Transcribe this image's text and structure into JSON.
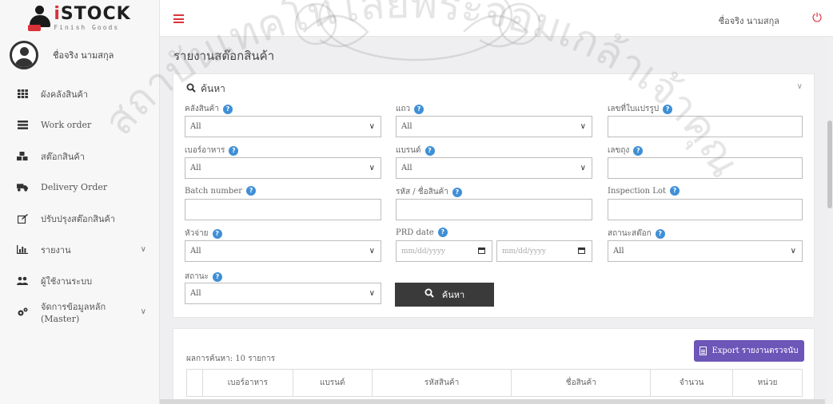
{
  "brand": {
    "title_i": "i",
    "title_rest": "STOCK",
    "subtitle": "Finish Goods",
    "emblem_text": "สถาบัน"
  },
  "colors": {
    "accent": "#d9323a",
    "export": "#6c56b8",
    "help": "#3f8fd6",
    "search_button": "#3a3a3a"
  },
  "sidebar": {
    "user_name": "ชื่อจริง นามสกุล",
    "items": [
      {
        "label": "ผังคลังสินค้า",
        "icon": "grid-icon"
      },
      {
        "label": "Work order",
        "icon": "list-icon"
      },
      {
        "label": "สต๊อกสินค้า",
        "icon": "cubes-icon"
      },
      {
        "label": "Delivery Order",
        "icon": "truck-icon"
      },
      {
        "label": "ปรับปรุงสต๊อกสินค้า",
        "icon": "edit-icon"
      },
      {
        "label": "รายงาน",
        "icon": "bar-chart-icon",
        "chevron": "∨"
      },
      {
        "label": "ผู้ใช้งานระบบ",
        "icon": "users-icon"
      },
      {
        "label": "จัดการข้อมูลหลัก (Master)",
        "icon": "gears-icon",
        "chevron": "∨"
      }
    ]
  },
  "topbar": {
    "user_name": "ชื่อจริง นามสกุล"
  },
  "page": {
    "title": "รายงานสต๊อกสินค้า"
  },
  "search_panel": {
    "title": "ค้นหา",
    "fields": {
      "warehouse": {
        "label": "คลังสินค้า",
        "value": "All"
      },
      "row": {
        "label": "แถว",
        "value": "All"
      },
      "transfer_no": {
        "label": "เลขที่ใบแปรรูป",
        "value": ""
      },
      "food_no": {
        "label": "เบอร์อาหาร",
        "value": "All"
      },
      "brand": {
        "label": "แบรนด์",
        "value": "All"
      },
      "bag_no": {
        "label": "เลขถุง",
        "value": ""
      },
      "batch": {
        "label": "Batch number",
        "value": ""
      },
      "product": {
        "label": "รหัส / ชื่อสินค้า",
        "value": ""
      },
      "inspection_lot": {
        "label": "Inspection Lot",
        "value": ""
      },
      "header": {
        "label": "หัวจ่าย",
        "value": "All"
      },
      "prd_date": {
        "label": "PRD date",
        "from_placeholder": "mm/dd/yyyy",
        "to_placeholder": "mm/dd/yyyy"
      },
      "stock_status": {
        "label": "สถานะสต๊อก",
        "value": "All"
      },
      "status": {
        "label": "สถานะ",
        "value": "All"
      }
    },
    "search_button": "ค้นหา"
  },
  "results": {
    "count_text": "ผลการค้นหา: 10 รายการ",
    "export_button": "Export รายงานตรวจนับ",
    "columns": [
      "",
      "เบอร์อาหาร",
      "แบรนด์",
      "รหัสสินค้า",
      "ชื่อสินค้า",
      "จำนวน",
      "หน่วย"
    ]
  },
  "watermark": {
    "text": "สถาบันเทคโนโลยีพระจอมเกล้าเจ้าคุณทหารลาดกระบัง"
  }
}
